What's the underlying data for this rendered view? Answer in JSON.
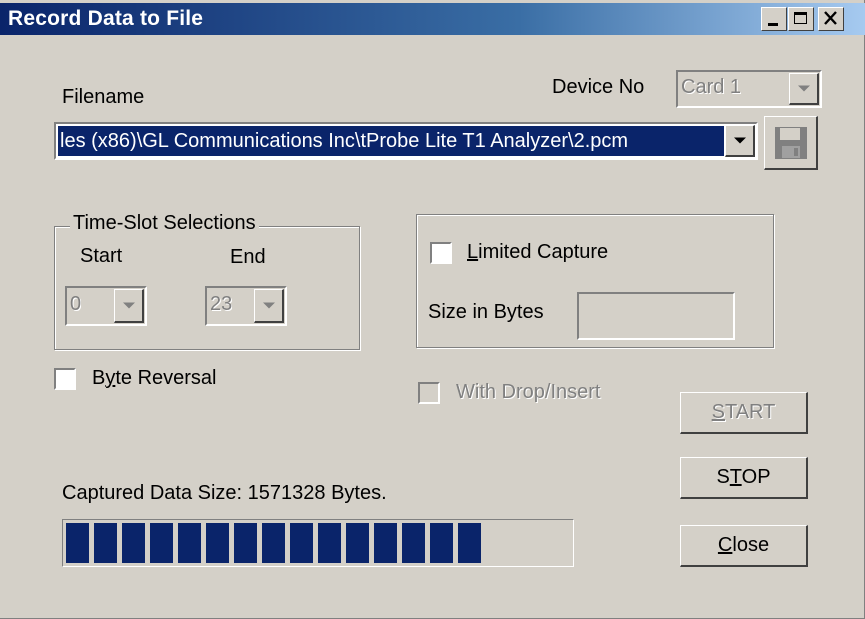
{
  "window": {
    "title": "Record Data to File",
    "controls": [
      "minimize-icon",
      "maximize-icon",
      "close-icon"
    ]
  },
  "device": {
    "label": "Device No",
    "value": "Card 1"
  },
  "filename": {
    "label": "Filename",
    "value": "les (x86)\\GL Communications Inc\\tProbe Lite T1 Analyzer\\2.pcm",
    "save_icon": "floppy-disk-icon"
  },
  "timeslot": {
    "caption": "Time-Slot Selections",
    "start_label": "Start",
    "end_label": "End",
    "start_value": "0",
    "end_value": "23"
  },
  "limited": {
    "checkbox_label": "Limited Capture",
    "checked": false,
    "size_label": "Size in Bytes",
    "size_value": ""
  },
  "byte_reversal": {
    "label": "Byte Reversal",
    "checked": false
  },
  "drop_insert": {
    "label": "With Drop/Insert",
    "checked": false
  },
  "buttons": {
    "start": "START",
    "stop": "STOP",
    "close": "Close"
  },
  "status": {
    "captured": "Captured Data Size: 1571328 Bytes.",
    "progress_fraction": 0.83
  },
  "colors": {
    "selection": "#0a246a",
    "face": "#d4d0c8",
    "progress": "#0a246a"
  }
}
